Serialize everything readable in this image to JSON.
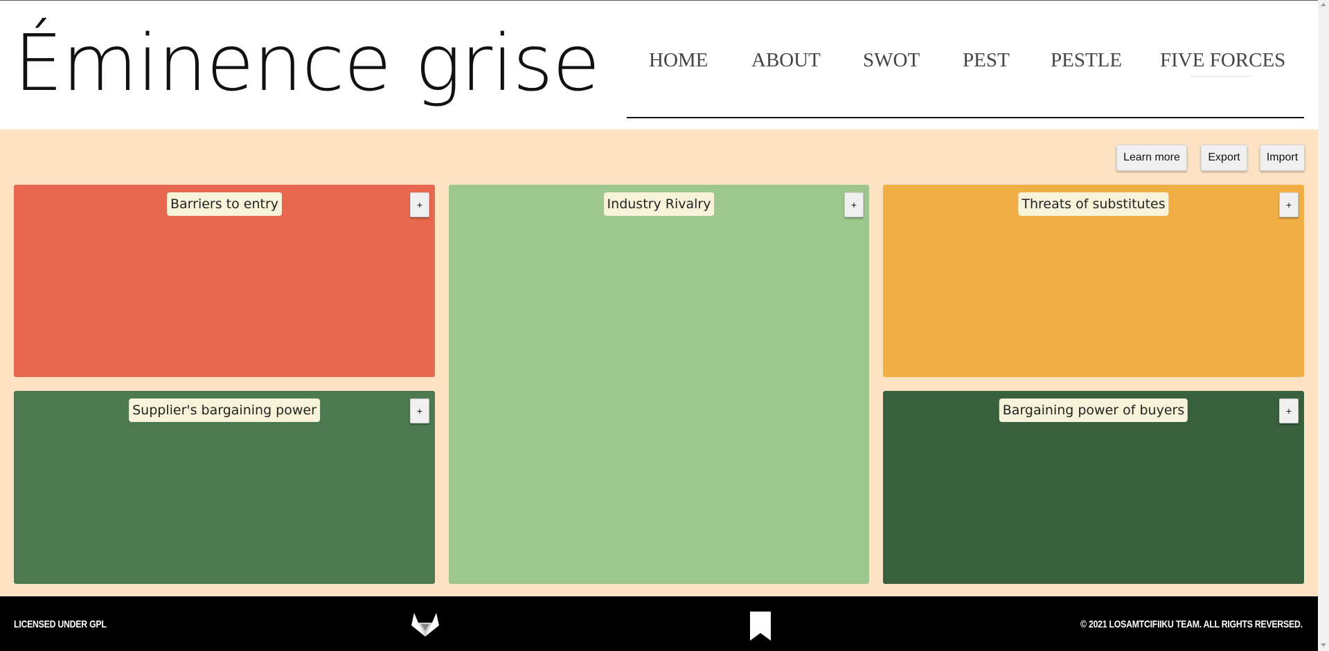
{
  "app": {
    "logo_text": "Éminence grise"
  },
  "nav": {
    "items": [
      "HOME",
      "ABOUT",
      "SWOT",
      "PEST",
      "PESTLE",
      "FIVE FORCES"
    ]
  },
  "toolbar": {
    "learn_more_label": "Learn more",
    "export_label": "Export",
    "import_label": "Import"
  },
  "panels": {
    "barriers": {
      "title": "Barriers to entry",
      "add_label": "+",
      "color": "#e8684f"
    },
    "rivalry": {
      "title": "Industry Rivalry",
      "add_label": "+",
      "color": "#9dc78c"
    },
    "substitutes": {
      "title": "Threats of substitutes",
      "add_label": "+",
      "color": "#f0ae45"
    },
    "suppliers": {
      "title": "Supplier's bargaining power",
      "add_label": "+",
      "color": "#4d7950"
    },
    "buyers": {
      "title": "Bargaining power of buyers",
      "add_label": "+",
      "color": "#38603d"
    }
  },
  "footer": {
    "license_text": "LICENSED UNDER GPL",
    "copyright_text": "© 2021 LOSAMTCIFIIKU TEAM. ALL RIGHTS REVERSED.",
    "gitlab_icon": "gitlab-icon",
    "bookmark_icon": "bookmark-icon"
  },
  "colors": {
    "page_background": "#fde2c4",
    "header_background": "#ffffff",
    "footer_background": "#000000"
  }
}
